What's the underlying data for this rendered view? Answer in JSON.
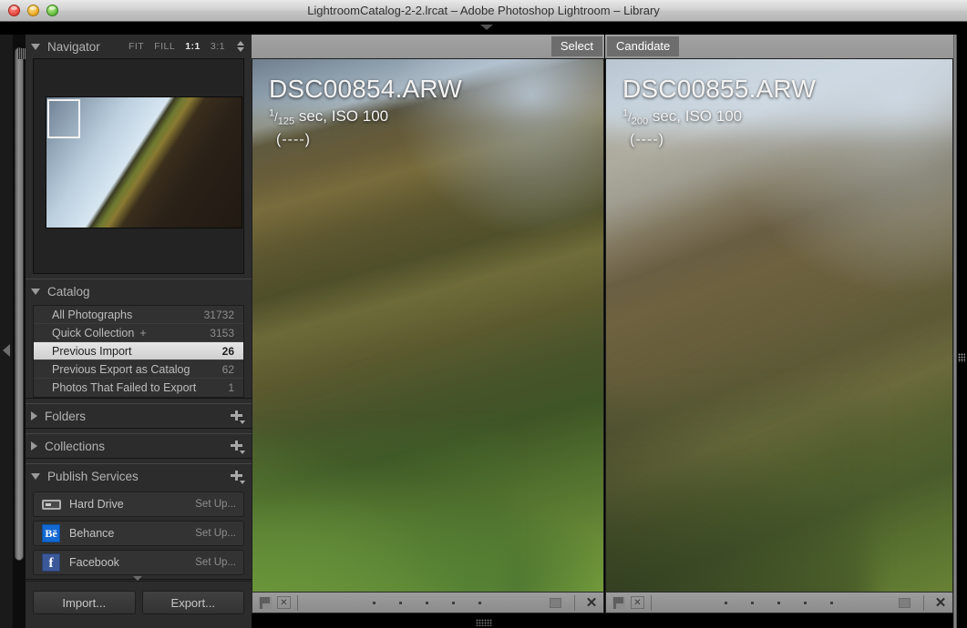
{
  "window": {
    "title": "LightroomCatalog-2-2.lrcat – Adobe Photoshop Lightroom – Library",
    "traffic_lights": [
      "close",
      "minimize",
      "zoom"
    ],
    "colors": {
      "close": "#e5463c",
      "minimize": "#e8a723",
      "zoom": "#5cb73b",
      "titlebar": "#d2d2d2"
    }
  },
  "navigator": {
    "title": "Navigator",
    "zoom_levels": [
      {
        "label": "FIT",
        "active": false
      },
      {
        "label": "FILL",
        "active": false
      },
      {
        "label": "1:1",
        "active": true
      },
      {
        "label": "3:1",
        "active": false
      }
    ]
  },
  "catalog": {
    "title": "Catalog",
    "items": [
      {
        "name": "All Photographs",
        "count": "31732",
        "selected": false
      },
      {
        "name": "Quick Collection",
        "plus": "+",
        "count": "3153",
        "selected": false
      },
      {
        "name": "Previous Import",
        "count": "26",
        "selected": true
      },
      {
        "name": "Previous Export as Catalog",
        "count": "62",
        "selected": false
      },
      {
        "name": "Photos That Failed to Export",
        "count": "1",
        "selected": false
      }
    ]
  },
  "folders": {
    "title": "Folders",
    "expanded": false
  },
  "collections": {
    "title": "Collections",
    "expanded": false
  },
  "publish_services": {
    "title": "Publish Services",
    "expanded": true,
    "items": [
      {
        "name": "Hard Drive",
        "action": "Set Up...",
        "icon": "hard-drive-icon"
      },
      {
        "name": "Behance",
        "action": "Set Up...",
        "icon": "behance-icon",
        "glyph": "Bē",
        "color": "#1269d3"
      },
      {
        "name": "Facebook",
        "action": "Set Up...",
        "icon": "facebook-icon",
        "glyph": "f",
        "color": "#3b5998"
      }
    ]
  },
  "sidebar_buttons": {
    "import": "Import...",
    "export": "Export..."
  },
  "compare": {
    "select": {
      "header": "Select",
      "filename": "DSC00854.ARW",
      "shutter_numerator": "1",
      "shutter_denominator": "125",
      "exif_tail": "sec, ISO 100",
      "note": "(----)"
    },
    "candidate": {
      "header": "Candidate",
      "filename": "DSC00855.ARW",
      "shutter_numerator": "1",
      "shutter_denominator": "200",
      "exif_tail": "sec, ISO 100",
      "note": "(----)"
    }
  },
  "toolbar": {
    "flag_icon": "flag-icon",
    "reject_icon": "reject-flag-icon",
    "reject_glyph": "✕",
    "rating_dots": 5,
    "close_glyph": "✕"
  }
}
